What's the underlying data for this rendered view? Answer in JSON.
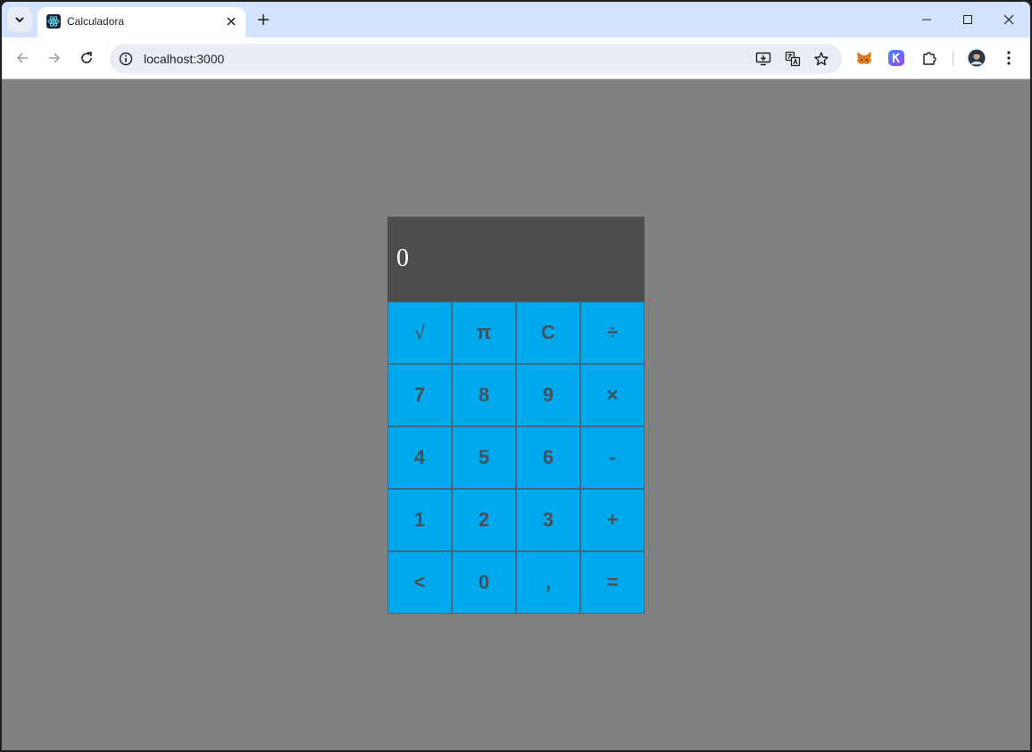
{
  "browser": {
    "tab_title": "Calculadora",
    "url": "localhost:3000"
  },
  "calculator": {
    "display": "0",
    "keys": [
      [
        "√",
        "π",
        "C",
        "÷"
      ],
      [
        "7",
        "8",
        "9",
        "×"
      ],
      [
        "4",
        "5",
        "6",
        "-"
      ],
      [
        "1",
        "2",
        "3",
        "+"
      ],
      [
        "<",
        "0",
        ",",
        "="
      ]
    ]
  },
  "colors": {
    "page_background": "#808080",
    "display_background": "#4d4d4d",
    "key_background": "#00a8ec",
    "key_text": "#44515a"
  }
}
